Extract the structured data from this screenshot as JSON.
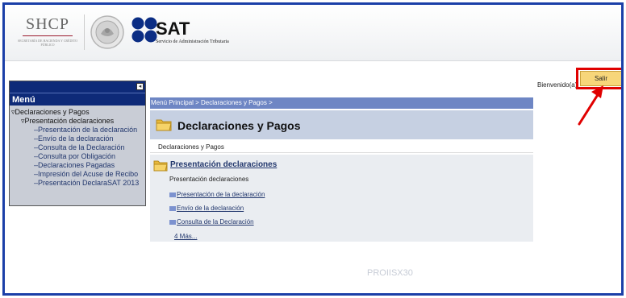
{
  "header": {
    "shcp_title": "SHCP",
    "shcp_subtitle": "SECRETARÍA DE HACIENDA Y CRÉDITO PÚBLICO",
    "sat_name": "SAT",
    "sat_description": "Servicio de Administración Tributaria",
    "icons": [
      "seal-icon",
      "sat-logo-icon"
    ]
  },
  "sidebar": {
    "collapse_label": "◂",
    "menu_title": "Menú",
    "items": [
      {
        "label": "▿Declaraciones y Pagos",
        "level": 1
      },
      {
        "label": "▿Presentación declaraciones",
        "level": 2
      },
      {
        "label": "–Presentación de la declaración",
        "level": 3
      },
      {
        "label": "–Envío de la declaración",
        "level": 3
      },
      {
        "label": "–Consulta de la Declaración",
        "level": 3
      },
      {
        "label": "–Consulta por Obligación",
        "level": 3
      },
      {
        "label": "–Declaraciones Pagadas",
        "level": 3
      },
      {
        "label": "–Impresión del Acuse de Recibo",
        "level": 3
      },
      {
        "label": "–Presentación DeclaraSAT 2013",
        "level": 3
      }
    ]
  },
  "topbar": {
    "welcome": "Bienvenido(a)",
    "logout_label": "Salir"
  },
  "content": {
    "breadcrumb": "Menú Principal > Declaraciones y Pagos >",
    "title": "Declaraciones y Pagos",
    "subtitle": "Declaraciones y Pagos",
    "section": {
      "title": "Presentación declaraciones",
      "subtitle": "Presentación declaraciones",
      "links": [
        "Presentación de la declaración",
        "Envío de la declaración",
        "Consulta de la Declaración"
      ],
      "more": "4 Más..."
    }
  },
  "footer": {
    "page_id": "PROIISX30"
  },
  "colors": {
    "frame": "#1b3fa8",
    "menu_bar": "#0e2a78",
    "breadcrumb": "#6e86c4",
    "title_bar": "#c6d0e2",
    "logout_button": "#f7d67a",
    "highlight": "#e00000"
  }
}
